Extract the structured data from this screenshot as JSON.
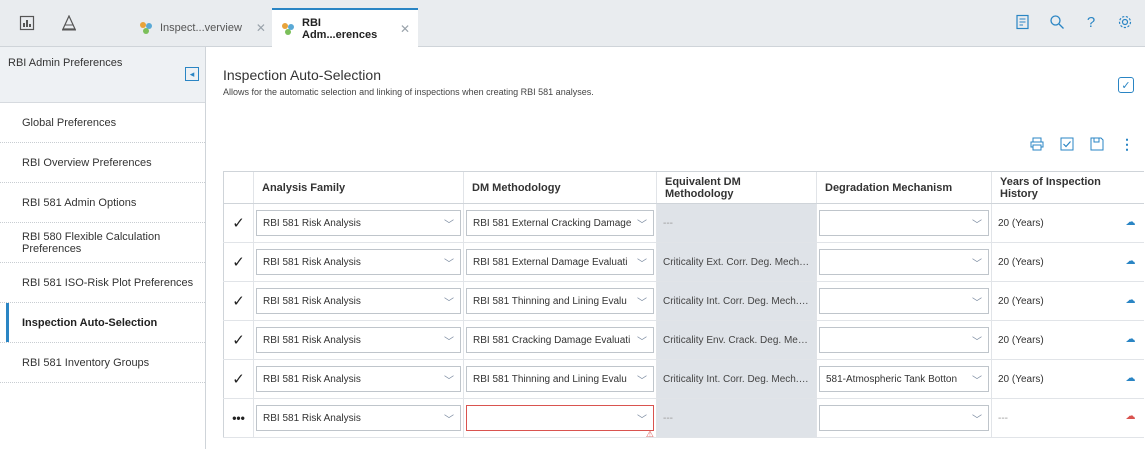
{
  "tabs": [
    {
      "label": "Inspect...verview",
      "active": false
    },
    {
      "label": "RBI Adm...erences",
      "active": true
    }
  ],
  "sidebar": {
    "title": "RBI Admin Preferences",
    "items": [
      {
        "label": "Global Preferences",
        "active": false
      },
      {
        "label": "RBI Overview Preferences",
        "active": false
      },
      {
        "label": "RBI 581 Admin Options",
        "active": false
      },
      {
        "label": "RBI 580 Flexible Calculation Preferences",
        "active": false
      },
      {
        "label": "RBI 581 ISO-Risk Plot Preferences",
        "active": false
      },
      {
        "label": "Inspection Auto-Selection",
        "active": true
      },
      {
        "label": "RBI 581 Inventory Groups",
        "active": false
      }
    ]
  },
  "main": {
    "title": "Inspection Auto-Selection",
    "description": "Allows for the automatic selection and linking of inspections when creating RBI 581 analyses."
  },
  "table": {
    "columns": [
      "",
      "Analysis Family",
      "DM Methodology",
      "Equivalent DM Methodology",
      "Degradation Mechanism",
      "Years of Inspection History"
    ],
    "rows": [
      {
        "status": "✓",
        "family": "RBI 581 Risk Analysis",
        "dm": "RBI 581 External Cracking Damage",
        "equiv": "---",
        "degradation": "",
        "years": "20 (Years)"
      },
      {
        "status": "✓",
        "family": "RBI 581 Risk Analysis",
        "dm": "RBI 581 External Damage Evaluati",
        "equiv": "Criticality Ext. Corr. Deg. Mech. ...",
        "degradation": "",
        "years": "20 (Years)"
      },
      {
        "status": "✓",
        "family": "RBI 581 Risk Analysis",
        "dm": "RBI 581 Thinning and Lining Evalu",
        "equiv": "Criticality Int. Corr. Deg. Mech. E...",
        "degradation": "",
        "years": "20 (Years)"
      },
      {
        "status": "✓",
        "family": "RBI 581 Risk Analysis",
        "dm": "RBI 581 Cracking Damage Evaluati",
        "equiv": "Criticality Env. Crack. Deg. Mech...",
        "degradation": "",
        "years": "20 (Years)"
      },
      {
        "status": "✓",
        "family": "RBI 581 Risk Analysis",
        "dm": "RBI 581 Thinning and Lining Evalu",
        "equiv": "Criticality Int. Corr. Deg. Mech. E...",
        "degradation": "581-Atmospheric Tank Botton",
        "years": "20 (Years)"
      },
      {
        "status": "•••",
        "family": "RBI 581 Risk Analysis",
        "dm": "",
        "equiv": "---",
        "degradation": "",
        "years": "---"
      }
    ]
  },
  "colors": {
    "accent": "#2a85c4",
    "error": "#d9534f",
    "readonly_bg": "#dfe3e8"
  }
}
